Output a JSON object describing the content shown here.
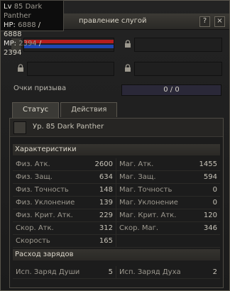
{
  "tooltip": {
    "lv_label": "Lv",
    "lv_value": "85 Dark Panther",
    "hp_label": "HP:",
    "hp_current": "6888",
    "hp_max": "6888",
    "mp_label": "MP:",
    "mp_current": "2394",
    "mp_max": "2394"
  },
  "window": {
    "title": "правление слугой"
  },
  "summon": {
    "label": "Очки призыва",
    "value": "0 / 0"
  },
  "tabs": [
    {
      "label": "Статус"
    },
    {
      "label": "Действия"
    }
  ],
  "panel": {
    "name": "Ур. 85 Dark Panther",
    "section_stats": "Характеристики",
    "section_charges": "Расход зарядов",
    "stats": [
      {
        "l1": "Физ. Атк.",
        "v1": "2600",
        "l2": "Маг. Атк.",
        "v2": "1455"
      },
      {
        "l1": "Физ. Защ.",
        "v1": "634",
        "l2": "Маг. Защ.",
        "v2": "594"
      },
      {
        "l1": "Физ. Точность",
        "v1": "148",
        "l2": "Маг. Точность",
        "v2": "0"
      },
      {
        "l1": "Физ. Уклонение",
        "v1": "139",
        "l2": "Маг. Уклонение",
        "v2": "0"
      },
      {
        "l1": "Физ. Крит. Атк.",
        "v1": "229",
        "l2": "Маг. Крит. Атк.",
        "v2": "120"
      },
      {
        "l1": "Скор. Атк.",
        "v1": "312",
        "l2": "Скор. Маг.",
        "v2": "346"
      },
      {
        "l1": "Скорость",
        "v1": "165",
        "l2": "",
        "v2": ""
      }
    ],
    "charges": [
      {
        "l1": "Исп. Заряд Души",
        "v1": "5",
        "l2": "Исп. Заряд Духа",
        "v2": "2"
      }
    ]
  },
  "colors": {
    "hp_bar": "#b51e1e",
    "mp_bar": "#2047b2"
  },
  "bars": {
    "hp_fraction": 1.0,
    "mp_fraction": 1.0
  }
}
